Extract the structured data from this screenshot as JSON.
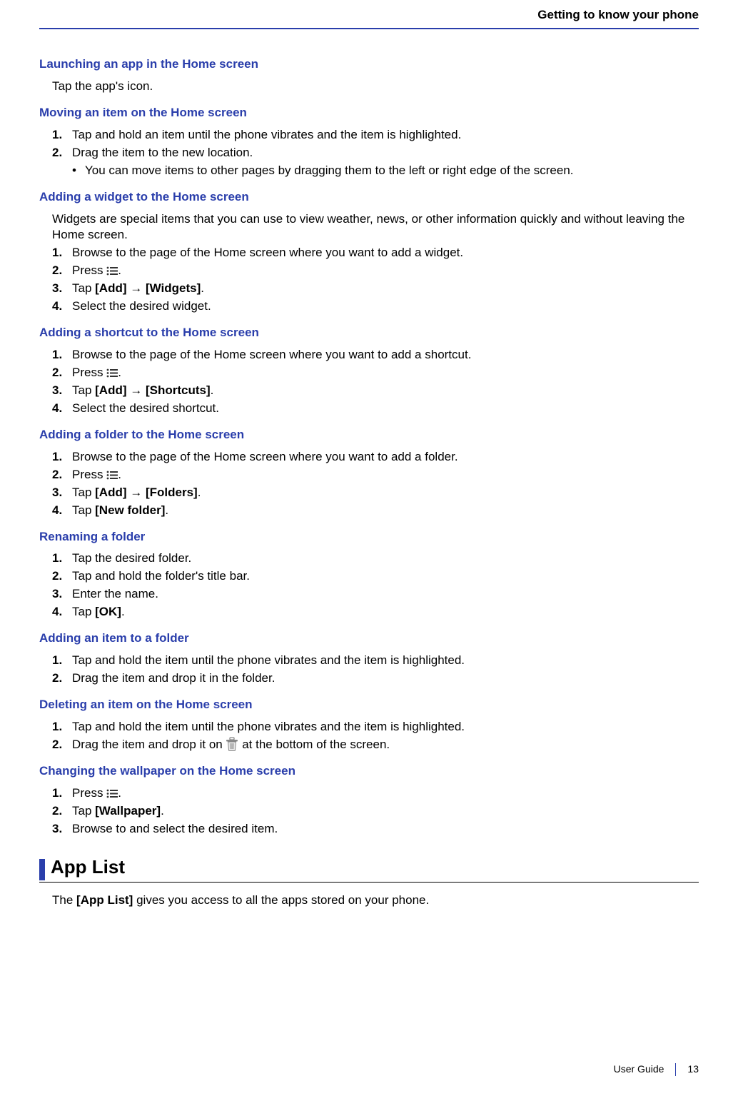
{
  "header": "Getting to know your phone",
  "sections": [
    {
      "title": "Launching an app in the Home screen",
      "body": "Tap the app's icon."
    },
    {
      "title": "Moving an item on the Home screen",
      "steps": [
        {
          "n": "1.",
          "text": "Tap and hold an item until the phone vibrates and the item is highlighted."
        },
        {
          "n": "2.",
          "text": "Drag the item to the new location.",
          "sub": [
            "You can move items to other pages by dragging them to the left or right edge of the screen."
          ]
        }
      ]
    },
    {
      "title": "Adding a widget to the Home screen",
      "intro": "Widgets are special items that you can use to view weather, news, or other information quickly and without leaving the Home screen.",
      "steps": [
        {
          "n": "1.",
          "text": "Browse to the page of the Home screen where you want to add a widget."
        },
        {
          "n": "2.",
          "pre": "Press ",
          "icon": "menu",
          "post": "."
        },
        {
          "n": "3.",
          "rich": [
            {
              "t": "Tap "
            },
            {
              "b": "[Add]"
            },
            {
              "t": " → "
            },
            {
              "b": "[Widgets]"
            },
            {
              "t": "."
            }
          ]
        },
        {
          "n": "4.",
          "text": "Select the desired widget."
        }
      ]
    },
    {
      "title": "Adding a shortcut to the Home screen",
      "steps": [
        {
          "n": "1.",
          "text": "Browse to the page of the Home screen where you want to add a shortcut."
        },
        {
          "n": "2.",
          "pre": "Press ",
          "icon": "menu",
          "post": "."
        },
        {
          "n": "3.",
          "rich": [
            {
              "t": "Tap "
            },
            {
              "b": "[Add]"
            },
            {
              "t": " → "
            },
            {
              "b": "[Shortcuts]"
            },
            {
              "t": "."
            }
          ]
        },
        {
          "n": "4.",
          "text": "Select the desired shortcut."
        }
      ]
    },
    {
      "title": "Adding a folder to the Home screen",
      "steps": [
        {
          "n": "1.",
          "text": "Browse to the page of the Home screen where you want to add a folder."
        },
        {
          "n": "2.",
          "pre": "Press ",
          "icon": "menu",
          "post": "."
        },
        {
          "n": "3.",
          "rich": [
            {
              "t": "Tap "
            },
            {
              "b": "[Add]"
            },
            {
              "t": " → "
            },
            {
              "b": "[Folders]"
            },
            {
              "t": "."
            }
          ]
        },
        {
          "n": "4.",
          "rich": [
            {
              "t": "Tap "
            },
            {
              "b": "[New folder]"
            },
            {
              "t": "."
            }
          ]
        }
      ]
    },
    {
      "title": "Renaming a folder",
      "steps": [
        {
          "n": "1.",
          "text": "Tap the desired folder."
        },
        {
          "n": "2.",
          "text": "Tap and hold the folder's title bar."
        },
        {
          "n": "3.",
          "text": "Enter the name."
        },
        {
          "n": "4.",
          "rich": [
            {
              "t": "Tap "
            },
            {
              "b": "[OK]"
            },
            {
              "t": "."
            }
          ]
        }
      ]
    },
    {
      "title": "Adding an item to a folder",
      "steps": [
        {
          "n": "1.",
          "text": "Tap and hold the item until the phone vibrates and the item is highlighted."
        },
        {
          "n": "2.",
          "text": "Drag the item and drop it in the folder."
        }
      ]
    },
    {
      "title": "Deleting an item on the Home screen",
      "steps": [
        {
          "n": "1.",
          "text": "Tap and hold the item until the phone vibrates and the item is highlighted."
        },
        {
          "n": "2.",
          "pre": "Drag the item and drop it on ",
          "icon": "trash",
          "post": " at the bottom of the screen."
        }
      ]
    },
    {
      "title": "Changing the wallpaper on the Home screen",
      "steps": [
        {
          "n": "1.",
          "pre": "Press ",
          "icon": "menu",
          "post": "."
        },
        {
          "n": "2.",
          "rich": [
            {
              "t": "Tap "
            },
            {
              "b": "[Wallpaper]"
            },
            {
              "t": "."
            }
          ]
        },
        {
          "n": "3.",
          "text": "Browse to and select the desired item."
        }
      ]
    }
  ],
  "major": {
    "title": "App List",
    "body_pre": "The ",
    "body_bold": "[App List]",
    "body_post": " gives you access to all the apps stored on your phone."
  },
  "footer": {
    "label": "User Guide",
    "page": "13"
  }
}
